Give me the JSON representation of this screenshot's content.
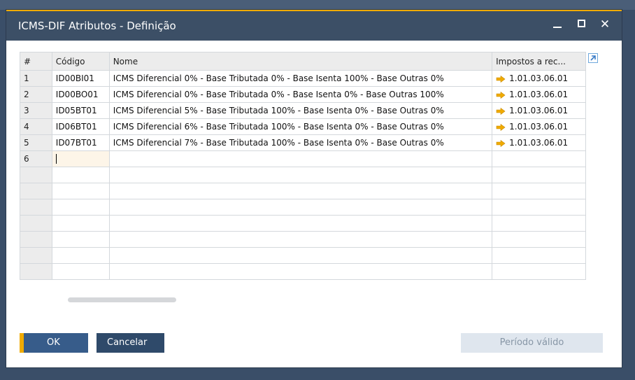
{
  "window": {
    "title": "ICMS-DIF Atributos - Definição",
    "minimize": "_",
    "close": "✕"
  },
  "grid": {
    "headers": {
      "num": "#",
      "codigo": "Código",
      "nome": "Nome",
      "impostos": "Impostos a rec..."
    },
    "rows": [
      {
        "num": "1",
        "codigo": "ID00BI01",
        "nome": "ICMS Diferencial 0% - Base Tributada 0% - Base Isenta 100% - Base Outras 0%",
        "conta": "1.01.03.06.01"
      },
      {
        "num": "2",
        "codigo": "ID00BO01",
        "nome": "ICMS Diferencial 0% - Base Tributada 0% - Base Isenta 0% - Base Outras 100%",
        "conta": "1.01.03.06.01"
      },
      {
        "num": "3",
        "codigo": "ID05BT01",
        "nome": "ICMS Diferencial 5% - Base Tributada 100% - Base Isenta 0% - Base Outras 0%",
        "conta": "1.01.03.06.01"
      },
      {
        "num": "4",
        "codigo": "ID06BT01",
        "nome": "ICMS Diferencial 6% - Base Tributada 100% - Base Isenta 0% - Base Outras 0%",
        "conta": "1.01.03.06.01"
      },
      {
        "num": "5",
        "codigo": "ID07BT01",
        "nome": "ICMS Diferencial 7% - Base Tributada 100% - Base Isenta 0% - Base Outras 0%",
        "conta": "1.01.03.06.01"
      }
    ],
    "new_row_num": "6"
  },
  "buttons": {
    "ok": "OK",
    "cancel": "Cancelar",
    "period": "Período válido"
  },
  "colors": {
    "accent": "#f0ab00",
    "titlebar": "#3c4f66",
    "link_arrow": "#f0ab00"
  }
}
